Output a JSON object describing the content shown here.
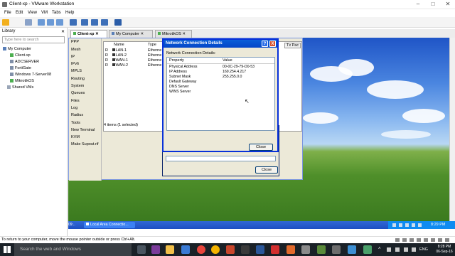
{
  "app": {
    "title": "Client-xp - VMware Workstation",
    "menu": [
      "File",
      "Edit",
      "View",
      "VM",
      "Tabs",
      "Help"
    ]
  },
  "library": {
    "header": "Library",
    "search_placeholder": "Type here to search",
    "root": "My Computer",
    "vms": [
      "Client-xp",
      "ADCSERVER",
      "FortiGate",
      "Windows 7-Server08",
      "MikrotikOS"
    ],
    "shared": "Shared VMs"
  },
  "tabs": [
    "Client-xp",
    "My Computer",
    "MikrotikOS"
  ],
  "winbox": {
    "menu": [
      "PPP",
      "Mesh",
      "IP",
      "IPv6",
      "MPLS",
      "Routing",
      "System",
      "Queues",
      "Files",
      "Log",
      "Radius",
      "Tools",
      "New Terminal",
      "KVM",
      "Make Supout.rif"
    ],
    "columns": [
      "Name",
      "Type"
    ],
    "col_right": "Tx Pac",
    "rows": [
      {
        "flag": "R",
        "name": "LAN-1",
        "type": "Etherne"
      },
      {
        "flag": "R",
        "name": "LAN-2",
        "type": "Etherne"
      },
      {
        "flag": "R",
        "name": "WAN-1",
        "type": "Etherne"
      },
      {
        "flag": "R",
        "name": "WAN-2",
        "type": "Etherne"
      }
    ],
    "footer": "4 items (1 selected)"
  },
  "net_details": {
    "title": "Network Connection Details",
    "help_btn": "?",
    "close_x": "X",
    "label": "Network Connection Details:",
    "col_property": "Property",
    "col_value": "Value",
    "rows": [
      {
        "property": "Physical Address",
        "value": "00-0C-29-79-D0-53"
      },
      {
        "property": "IP Address",
        "value": "169.254.4.217"
      },
      {
        "property": "Subnet Mask",
        "value": "255.255.0.0"
      },
      {
        "property": "Default Gateway",
        "value": ""
      },
      {
        "property": "DNS Server",
        "value": ""
      },
      {
        "property": "WINS Server",
        "value": ""
      }
    ],
    "close_label": "Close"
  },
  "status_dialog": {
    "close_label": "Close"
  },
  "guest_taskbar": {
    "task_label": "Local Area Connectio...",
    "start_fragment": "09:..",
    "clock": "8:29 PM"
  },
  "statusbar": {
    "message": "To return to your computer, move the mouse pointer outside or press Ctrl+Alt."
  },
  "win_taskbar": {
    "search_placeholder": "Search the web and Windows",
    "lang": "ENG",
    "time": "8:28 PM",
    "date": "06-Sep-16"
  },
  "colors": {
    "xp_blue": "#0a5fd8",
    "taskbar_dark": "#1a2127",
    "guest_taskbar": "#245edb"
  }
}
